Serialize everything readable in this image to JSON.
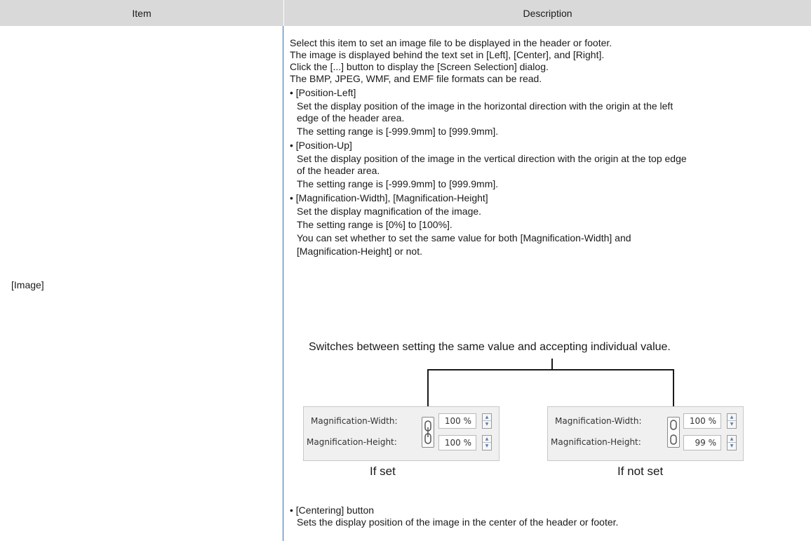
{
  "table": {
    "headers": {
      "item": "Item",
      "description": "Description"
    },
    "item_label": "[Image]"
  },
  "description": {
    "intro": [
      "Select this item to set an image file to be displayed in the header or footer.",
      "The image is displayed behind the text set in [Left], [Center], and [Right].",
      "Click the [...] button to display the [Screen Selection] dialog.",
      "The BMP, JPEG, WMF, and EMF file formats can be read."
    ],
    "position_left": {
      "title": "• [Position-Left]",
      "line1": "Set the display position of the image in the horizontal direction with the origin at the left",
      "line2": "edge of the header area.",
      "range": "The setting range is [-999.9mm] to [999.9mm]."
    },
    "position_up": {
      "title": "• [Position-Up]",
      "line1": "Set the display position of the image in the vertical direction with the origin at the top edge",
      "line2": "of the header area.",
      "range": "The setting range is [-999.9mm] to [999.9mm]."
    },
    "magnification": {
      "title": "• [Magnification-Width], [Magnification-Height]",
      "line1": "Set the display magnification of the image.",
      "range": "The setting range is [0%] to [100%].",
      "line3": "You can set whether to set the same value for both [Magnification-Width] and",
      "line4": "[Magnification-Height] or not."
    },
    "figure": {
      "caption": "Switches between setting the same value and accepting individual value.",
      "set_panel": {
        "width_label": "Magnification-Width:",
        "height_label": "Magnification-Height:",
        "width_value": "100 %",
        "height_value": "100 %",
        "caption": "If set"
      },
      "notset_panel": {
        "width_label": "Magnification-Width:",
        "height_label": "Magnification-Height:",
        "width_value": "100 %",
        "height_value": "99 %",
        "caption": "If not set"
      }
    },
    "centering": {
      "title": "• [Centering] button",
      "line1": "Sets the display position of the image in the center of the header or footer."
    }
  },
  "icons": {
    "link": "chain-link-icon",
    "spin_up": "spin-up-icon",
    "spin_down": "spin-down-icon"
  },
  "colors": {
    "header_bg": "#d9d9d9",
    "divider": "#2f6db3",
    "panel_bg": "#f0f0f0"
  }
}
